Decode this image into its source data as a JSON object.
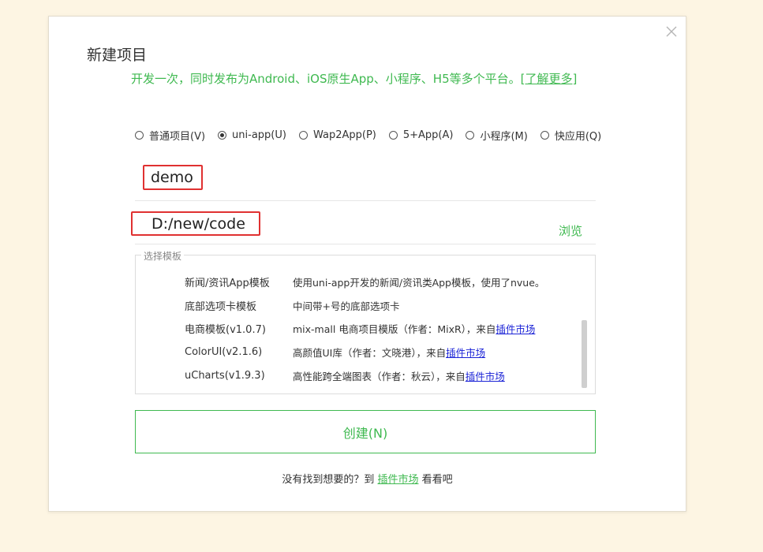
{
  "dialog": {
    "title": "新建项目",
    "subtitle": "开发一次，同时发布为Android、iOS原生App、小程序、H5等多个平台。",
    "learn_more": "[了解更多]",
    "close_icon": "close-icon"
  },
  "project_types": [
    {
      "label": "普通项目(V)",
      "checked": false
    },
    {
      "label": "uni-app(U)",
      "checked": true
    },
    {
      "label": "Wap2App(P)",
      "checked": false
    },
    {
      "label": "5+App(A)",
      "checked": false
    },
    {
      "label": "小程序(M)",
      "checked": false
    },
    {
      "label": "快应用(Q)",
      "checked": false
    }
  ],
  "project_name": {
    "value": "demo"
  },
  "project_path": {
    "value": "D:/new/code",
    "browse_label": "浏览"
  },
  "templates": {
    "legend": "选择模板",
    "items": [
      {
        "name": "新闻/资讯App模板",
        "desc": "使用uni-app开发的新闻/资讯类App模板，使用了nvue。",
        "link": ""
      },
      {
        "name": "底部选项卡模板",
        "desc": "中间带+号的底部选项卡",
        "link": ""
      },
      {
        "name": "电商模板(v1.0.7)",
        "desc": "mix-mall 电商项目模版（作者：MixR），来自",
        "link": "插件市场"
      },
      {
        "name": "ColorUI(v2.1.6)",
        "desc": "高颜值UI库（作者：文晓港），来自",
        "link": "插件市场"
      },
      {
        "name": "uCharts(v1.9.3)",
        "desc": "高性能跨全端图表（作者：秋云），来自",
        "link": "插件市场"
      }
    ]
  },
  "create_button": {
    "label": "创建(N)"
  },
  "footer": {
    "prefix": "没有找到想要的？到 ",
    "link": "插件市场",
    "suffix": " 看看吧"
  },
  "colors": {
    "accent": "#3fb950",
    "highlight_border": "#e03131",
    "link_blue": "#1a22d6",
    "background": "#fdf5e3"
  }
}
